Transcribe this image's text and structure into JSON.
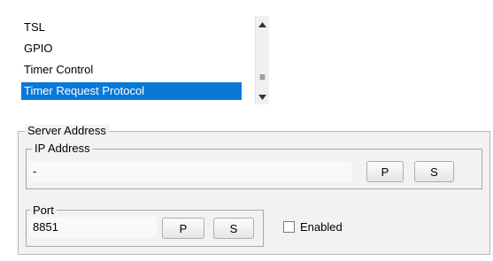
{
  "protocol_list": {
    "items": [
      {
        "label": "TSL",
        "selected": false
      },
      {
        "label": "GPIO",
        "selected": false
      },
      {
        "label": "Timer Control",
        "selected": false
      },
      {
        "label": "Timer Request Protocol",
        "selected": true
      }
    ],
    "scrollbar": {
      "up_glyph": "▲",
      "down_glyph": "▼",
      "thumb_grip": "≡"
    }
  },
  "server_address": {
    "title": "Server Address",
    "ip_address": {
      "title": "IP Address",
      "value": "-",
      "p_label": "P",
      "s_label": "S"
    },
    "port": {
      "title": "Port",
      "value": "8851",
      "p_label": "P",
      "s_label": "S"
    },
    "enabled": {
      "label": "Enabled",
      "checked": false
    }
  },
  "colors": {
    "selection": "#0a78d7",
    "panel": "#f2f2f2"
  }
}
